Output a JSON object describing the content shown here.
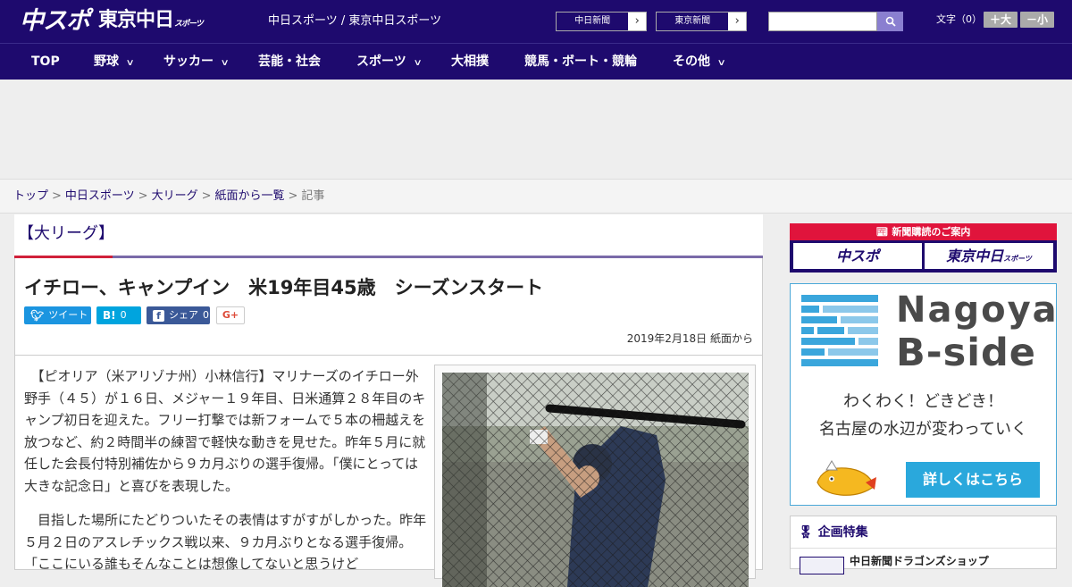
{
  "header": {
    "logo_main": "中スポ",
    "logo_tokyo": "東京中日",
    "logo_tokyo_sub": "スポーツ",
    "site_title": "中日スポーツ / 東京中日スポーツ",
    "paper_links": [
      "中日新聞",
      "東京新聞"
    ],
    "search": {
      "placeholder": "",
      "value": ""
    },
    "font_size_label": "文字（0）",
    "font_larger": "＋大",
    "font_smaller": "－小"
  },
  "nav": {
    "items": [
      {
        "label": "TOP",
        "has_dropdown": false
      },
      {
        "label": "野球",
        "has_dropdown": true
      },
      {
        "label": "サッカー",
        "has_dropdown": true
      },
      {
        "label": "芸能・社会",
        "has_dropdown": false
      },
      {
        "label": "スポーツ",
        "has_dropdown": true
      },
      {
        "label": "大相撲",
        "has_dropdown": false
      },
      {
        "label": "競馬・ボート・競輪",
        "has_dropdown": false
      },
      {
        "label": "その他",
        "has_dropdown": true
      }
    ]
  },
  "breadcrumb": {
    "links": [
      "トップ",
      "中日スポーツ",
      "大リーグ",
      "紙面から一覧"
    ],
    "current": "記事",
    "separator": ">"
  },
  "article": {
    "category": "【大リーグ】",
    "headline": "イチロー、キャンプイン　米19年目45歳　シーズンスタート",
    "share": {
      "tweet_label": "ツイート",
      "hatena_icon": "B!",
      "hatena_count": "0",
      "facebook_label": "シェア",
      "facebook_count": "0",
      "gplus_label": "G+"
    },
    "date": "2019年2月18日 紙面から",
    "paragraphs": [
      "　【ピオリア（米アリゾナ州）小林信行】マリナーズのイチロー外野手（４５）が１６日、メジャー１９年目、日米通算２８年目のキャンプ初日を迎えた。フリー打撃では新フォームで５本の柵越えを放つなど、約２時間半の練習で軽快な動きを見せた。昨年５月に就任した会長付特別補佐から９カ月ぶりの選手復帰。「僕にとっては大きな記念日」と喜びを表現した。",
      "　目指した場所にたどりついたその表情はすがすがしかった。昨年５月２日のアスレチックス戦以来、９カ月ぶりとなる選手復帰。「ここにいる誰もそんなことは想像してないと思うけど"
    ]
  },
  "sidebar": {
    "subscription": {
      "title": "新聞購読のご案内",
      "left": "中スポ",
      "right": "東京中日",
      "right_sub": "スポーツ"
    },
    "bside": {
      "line1": "Nagoya",
      "line2": "B-side",
      "tagline1": "わくわく！どきどき！",
      "tagline2": "名古屋の水辺が変わっていく",
      "cta": "詳しくはこちら"
    },
    "feature": {
      "title": "企画特集",
      "first_item": "中日新聞ドラゴンズショップ"
    }
  },
  "colors": {
    "brand_navy": "#1e0a6e",
    "accent_red": "#e0143c",
    "bside_blue": "#2aa8dc",
    "twitter": "#1b95e0",
    "hatena": "#00a4de",
    "facebook": "#3b5998"
  }
}
